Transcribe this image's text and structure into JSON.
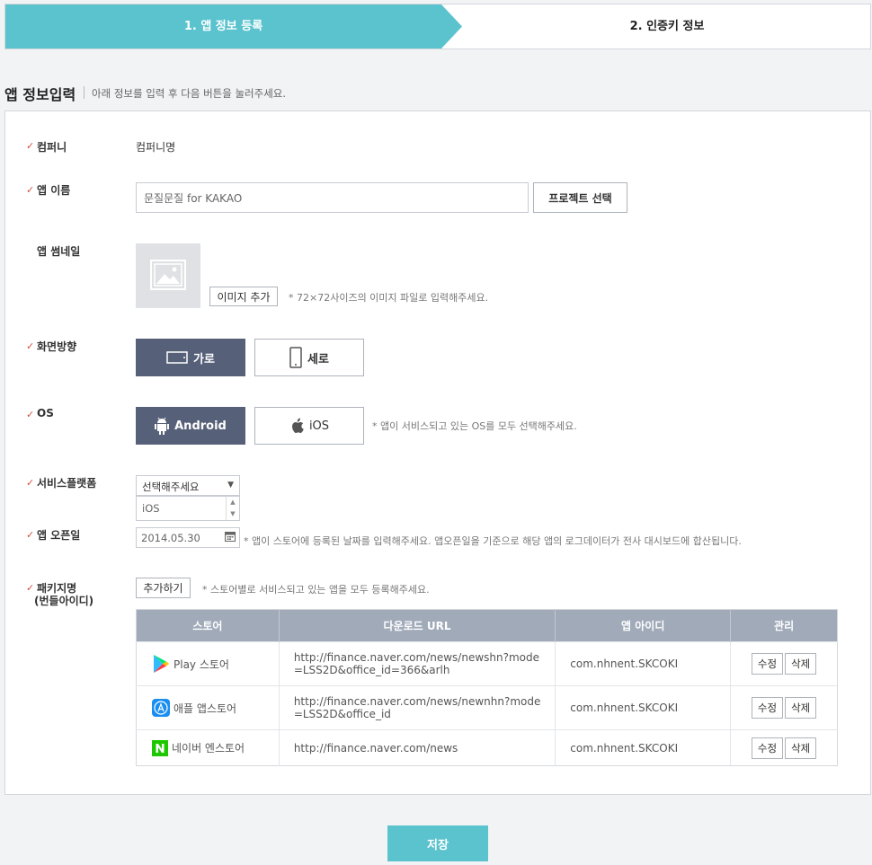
{
  "stepper": {
    "step1": "1. 앱 정보 등록",
    "step2": "2. 인증키 정보"
  },
  "section": {
    "title": "앱 정보입력",
    "desc": "아래 정보를 입력 후 다음 버튼을 눌러주세요."
  },
  "form": {
    "company": {
      "label": "컴퍼니",
      "value": "컴퍼니명"
    },
    "app_name": {
      "label": "앱 이름",
      "value": "문질문질 for KAKAO",
      "button": "프로젝트 선택"
    },
    "thumbnail": {
      "label": "앱 썸네일",
      "button": "이미지 추가",
      "note": "* 72×72사이즈의 이미지 파일로 입력해주세요."
    },
    "orientation": {
      "label": "화면방향",
      "options": [
        "가로",
        "세로"
      ],
      "selected": "가로"
    },
    "os": {
      "label": "OS",
      "options": [
        "Android",
        "iOS"
      ],
      "selected": "Android",
      "note": "* 앱이 서비스되고 있는 OS를 모두 선택해주세요."
    },
    "service_platform": {
      "label": "서비스플랫폼",
      "select": "선택해주세요",
      "list_value": "iOS"
    },
    "open_date": {
      "label": "앱 오픈일",
      "value": "2014.05.30",
      "note": "* 앱이 스토어에 등록된 날짜를 입력해주세요. 앱오픈일을 기준으로 해당 앱의 로그데이터가 전사 대시보드에 합산됩니다."
    },
    "package": {
      "label_line1": "패키지명",
      "label_line2": "(번들아이디)",
      "button": "추가하기",
      "note": "* 스토어별로 서비스되고 있는 앱을 모두 등록해주세요."
    }
  },
  "table": {
    "headers": [
      "스토어",
      "다운로드 URL",
      "앱 아이디",
      "관리"
    ],
    "rows": [
      {
        "store": "Play 스토어",
        "icon": "google-play-icon",
        "url": "http://finance.naver.com/news/newshn?mode=LSS2D&office_id=366&arlh",
        "app_id": "com.nhnent.SKCOKI",
        "edit": "수정",
        "delete": "삭제"
      },
      {
        "store": "애플 앱스토어",
        "icon": "apple-appstore-icon",
        "url": "http://finance.naver.com/news/newnhn?mode=LSS2D&office_id",
        "app_id": "com.nhnent.SKCOKI",
        "edit": "수정",
        "delete": "삭제"
      },
      {
        "store": "네이버 엔스토어",
        "icon": "naver-nstore-icon",
        "url": "http://finance.naver.com/news",
        "app_id": "com.nhnent.SKCOKI",
        "edit": "수정",
        "delete": "삭제"
      }
    ]
  },
  "save_button": "저장",
  "colors": {
    "accent": "#5ac3ce",
    "active_toggle": "#566078",
    "table_header": "#a0aab9",
    "check": "#d0523a"
  }
}
